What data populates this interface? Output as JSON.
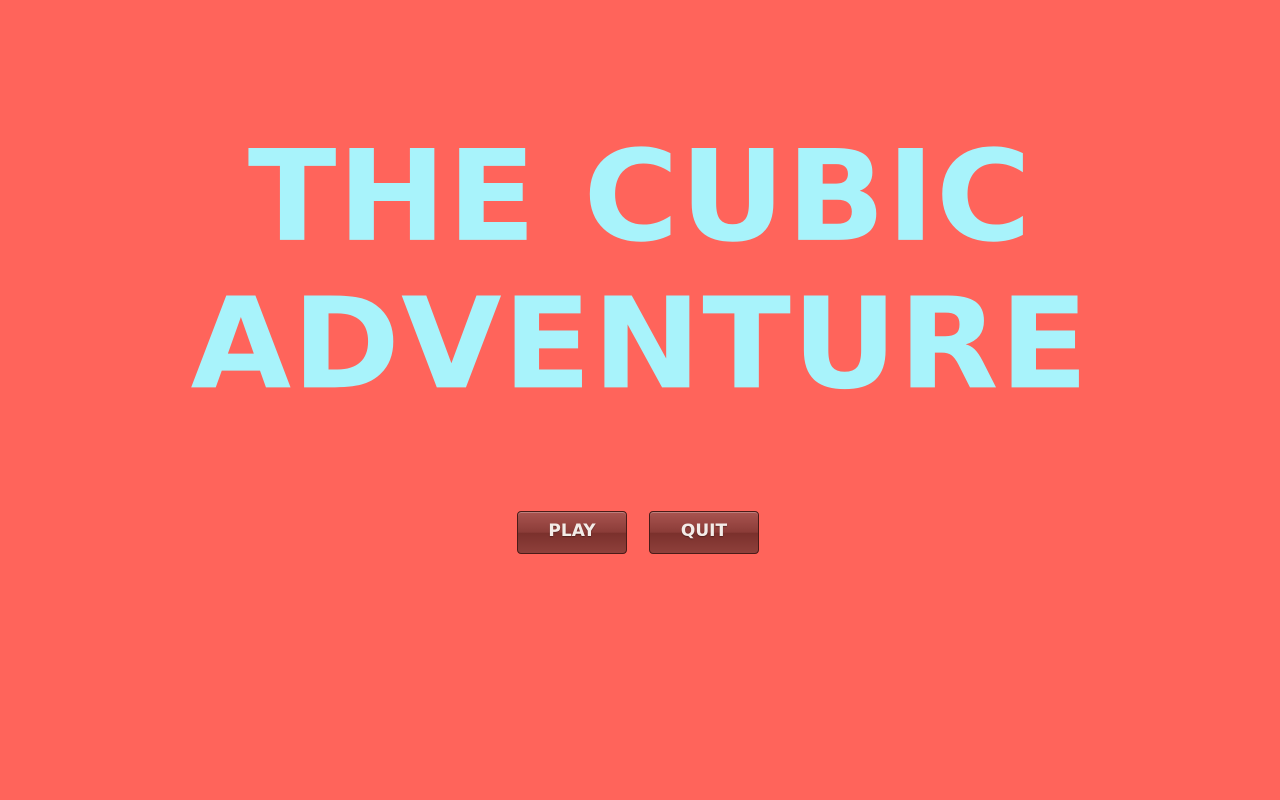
{
  "title": {
    "line1": "THE CUBIC",
    "line2": "ADVENTURE"
  },
  "menu": {
    "play_label": "PLAY",
    "quit_label": "QUIT"
  },
  "colors": {
    "background": "#ff645b",
    "title": "#a8f3fb",
    "button": "#8b3c38",
    "button_text": "#f3ece8"
  }
}
